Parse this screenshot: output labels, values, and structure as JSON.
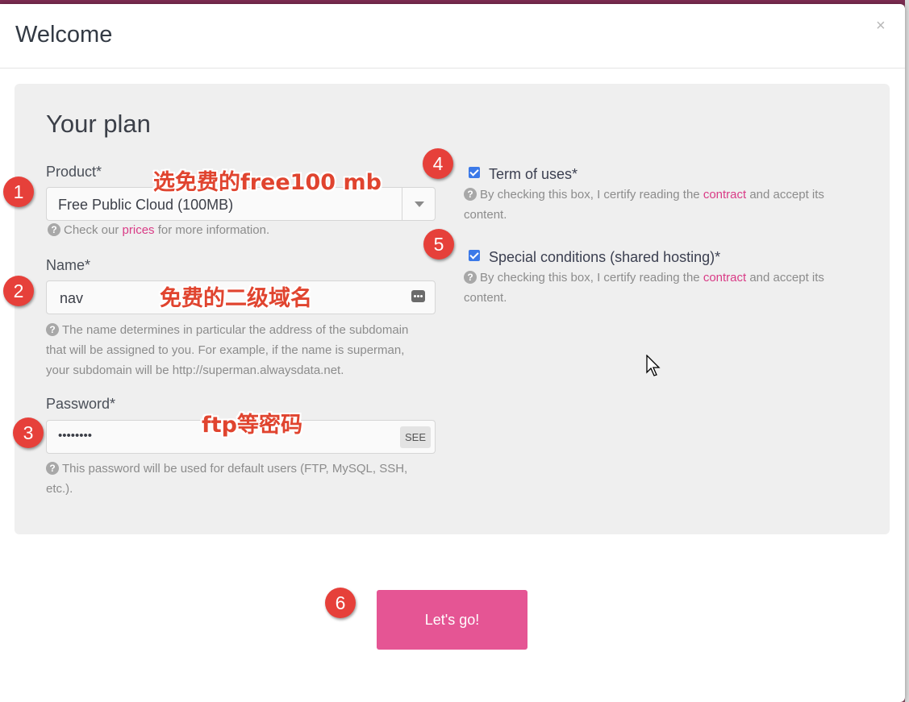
{
  "modal": {
    "title": "Welcome",
    "close_label": "×"
  },
  "plan": {
    "title": "Your plan",
    "product": {
      "label": "Product*",
      "value": "Free Public Cloud (100MB)",
      "help_prefix": "Check our",
      "help_link": "prices",
      "help_suffix": "for more information."
    },
    "name": {
      "label": "Name*",
      "value": "nav",
      "help_line1": "The name determines in particular the address of the subdomain",
      "help_line2": "that will be assigned to you. For example, if the name is superman,",
      "help_line3": "your subdomain will be http://superman.alwaysdata.net."
    },
    "password": {
      "label": "Password*",
      "value": "••••••••",
      "see_label": "SEE",
      "help_line1": "This password will be used for default users (FTP, MySQL, SSH,",
      "help_line2": "etc.)."
    },
    "terms": {
      "label": "Term of uses*",
      "checked": true,
      "help_prefix": "By checking this box, I certify reading the",
      "help_link": "contract",
      "help_suffix": "and accept its",
      "help_line2": "content."
    },
    "special": {
      "label": "Special conditions (shared hosting)*",
      "checked": true,
      "help_prefix": "By checking this box, I certify reading the",
      "help_link": "contract",
      "help_suffix": "and accept its",
      "help_line2": "content."
    }
  },
  "submit_label": "Let's go!",
  "annotations": {
    "a1": "选免费的free100 mb",
    "a2": "免费的二级域名",
    "a3": "ftp等密码",
    "badges": [
      "1",
      "2",
      "3",
      "4",
      "5",
      "6"
    ]
  },
  "colors": {
    "accent": "#e55594",
    "link": "#d93b86",
    "badge": "#e6403a",
    "checkbox": "#3b79e8"
  }
}
